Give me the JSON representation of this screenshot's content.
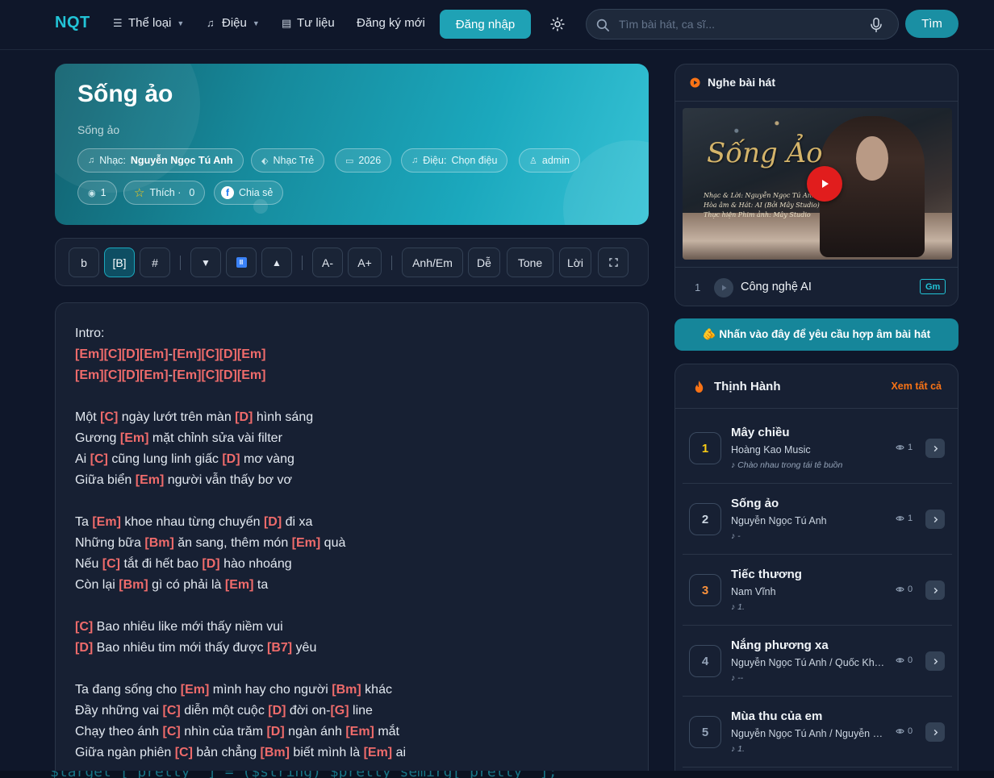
{
  "nav": {
    "logo": "NQT",
    "categories": "Thể loại",
    "rhythm": "Điệu",
    "resources": "Tư liệu",
    "register": "Đăng ký mới",
    "login": "Đăng nhập",
    "search_placeholder": "Tìm bài hát, ca sĩ...",
    "search_button": "Tìm"
  },
  "song": {
    "title": "Sống ảo",
    "subtitle": "Sống ảo",
    "composer_label": "Nhạc:",
    "composer": "Nguyễn Ngọc Tú Anh",
    "genre": "Nhạc Trẻ",
    "year": "2026",
    "rhythm_label": "Điệu:",
    "rhythm": "Chọn điệu",
    "uploader": "admin",
    "views": "1",
    "like_label": "Thích ·",
    "likes": "0",
    "share_label": "Chia sẻ"
  },
  "toolbar": {
    "flat": "b",
    "natural": "[B]",
    "sharp": "#",
    "down": "▼",
    "pause": "II",
    "up": "▲",
    "font_smaller": "A-",
    "font_bigger": "A+",
    "notation": "Anh/Em",
    "easy": "Dễ",
    "tone": "Tone",
    "lyrics_only": "Lời"
  },
  "lyrics": [
    [
      {
        "t": "Intro:"
      }
    ],
    [
      {
        "c": "[Em]"
      },
      {
        "c": "[C]"
      },
      {
        "c": "[D]"
      },
      {
        "c": "[Em]"
      },
      {
        "t": "-"
      },
      {
        "c": "[Em]"
      },
      {
        "c": "[C]"
      },
      {
        "c": "[D]"
      },
      {
        "c": "[Em]"
      }
    ],
    [
      {
        "c": "[Em]"
      },
      {
        "c": "[C]"
      },
      {
        "c": "[D]"
      },
      {
        "c": "[Em]"
      },
      {
        "t": "-"
      },
      {
        "c": "[Em]"
      },
      {
        "c": "[C]"
      },
      {
        "c": "[D]"
      },
      {
        "c": "[Em]"
      }
    ],
    [],
    [
      {
        "t": "Một "
      },
      {
        "c": "[C]"
      },
      {
        "t": " ngày lướt trên màn "
      },
      {
        "c": "[D]"
      },
      {
        "t": " hình sáng"
      }
    ],
    [
      {
        "t": "Gương "
      },
      {
        "c": "[Em]"
      },
      {
        "t": " mặt chỉnh sửa vài filter"
      }
    ],
    [
      {
        "t": "Ai "
      },
      {
        "c": "[C]"
      },
      {
        "t": " cũng lung linh giấc "
      },
      {
        "c": "[D]"
      },
      {
        "t": " mơ vàng"
      }
    ],
    [
      {
        "t": "Giữa biển "
      },
      {
        "c": "[Em]"
      },
      {
        "t": " người vẫn thấy bơ vơ"
      }
    ],
    [],
    [
      {
        "t": "Ta "
      },
      {
        "c": "[Em]"
      },
      {
        "t": " khoe nhau từng chuyến "
      },
      {
        "c": "[D]"
      },
      {
        "t": " đi xa"
      }
    ],
    [
      {
        "t": "Những bữa "
      },
      {
        "c": "[Bm]"
      },
      {
        "t": " ăn sang, thêm món "
      },
      {
        "c": "[Em]"
      },
      {
        "t": " quà"
      }
    ],
    [
      {
        "t": "Nếu "
      },
      {
        "c": "[C]"
      },
      {
        "t": " tắt đi hết bao "
      },
      {
        "c": "[D]"
      },
      {
        "t": " hào nhoáng"
      }
    ],
    [
      {
        "t": "Còn lại "
      },
      {
        "c": "[Bm]"
      },
      {
        "t": " gì có phải là "
      },
      {
        "c": "[Em]"
      },
      {
        "t": " ta"
      }
    ],
    [],
    [
      {
        "c": "[C]"
      },
      {
        "t": " Bao nhiêu like mới thấy niềm vui"
      }
    ],
    [
      {
        "c": "[D]"
      },
      {
        "t": " Bao nhiêu tim mới thấy được "
      },
      {
        "c": "[B7]"
      },
      {
        "t": " yêu"
      }
    ],
    [],
    [
      {
        "t": "Ta đang sống cho "
      },
      {
        "c": "[Em]"
      },
      {
        "t": " mình hay cho người "
      },
      {
        "c": "[Bm]"
      },
      {
        "t": " khác"
      }
    ],
    [
      {
        "t": "Đầy những vai "
      },
      {
        "c": "[C]"
      },
      {
        "t": " diễn một cuộc "
      },
      {
        "c": "[D]"
      },
      {
        "t": " đời on-"
      },
      {
        "c": "[G]"
      },
      {
        "t": " line"
      }
    ],
    [
      {
        "t": "Chạy theo ánh "
      },
      {
        "c": "[C]"
      },
      {
        "t": " nhìn của trăm "
      },
      {
        "c": "[D]"
      },
      {
        "t": " ngàn ánh "
      },
      {
        "c": "[Em]"
      },
      {
        "t": " mắt"
      }
    ],
    [
      {
        "t": "Giữa ngàn phiên "
      },
      {
        "c": "[C]"
      },
      {
        "t": " bản chẳng "
      },
      {
        "c": "[Bm]"
      },
      {
        "t": " biết mình là "
      },
      {
        "c": "[Em]"
      },
      {
        "t": " ai"
      }
    ]
  ],
  "player": {
    "title": "Nghe bài hát",
    "video_title": "Sống Ảo",
    "credits": [
      "Nhạc & Lời: Nguyễn Ngọc Tú Anh",
      "Hòa âm & Hát: AI (Bởi Mây Studio)",
      "Thực hiện Phim ảnh: Mây Studio"
    ],
    "track_num": "1",
    "track_name": "Công nghệ AI",
    "track_key": "Gm"
  },
  "request_button": "🫵 Nhấn vào đây để yêu cầu hợp âm bài hát",
  "trending": {
    "title": "Thịnh Hành",
    "see_all": "Xem tất cả",
    "items": [
      {
        "rank": "1",
        "title": "Mây chiều",
        "artist": "Hoàng Kao Music",
        "note": "♪ Chào nhau trong tái tê buồn",
        "views": "1",
        "color": "#facc15"
      },
      {
        "rank": "2",
        "title": "Sống ảo",
        "artist": "Nguyễn Ngọc Tú Anh",
        "note": "♪ -",
        "views": "1",
        "color": "#cbd5e1"
      },
      {
        "rank": "3",
        "title": "Tiếc thương",
        "artist": "Nam Vĩnh",
        "note": "♪ 1.",
        "views": "0",
        "color": "#fb923c"
      },
      {
        "rank": "4",
        "title": "Nắng phương xa",
        "artist": "Nguyễn Ngọc Tú Anh / Quốc Khánh",
        "note": "♪ --",
        "views": "0",
        "color": "#94a3b8"
      },
      {
        "rank": "5",
        "title": "Mùa thu của em",
        "artist": "Nguyễn Ngọc Tú Anh / Nguyễn Văn",
        "note": "♪ 1.",
        "views": "0",
        "color": "#94a3b8"
      }
    ]
  },
  "footer_snippet": "$target ['pretty_'] = ($string) $pretty_semirg['pretty_'];"
}
